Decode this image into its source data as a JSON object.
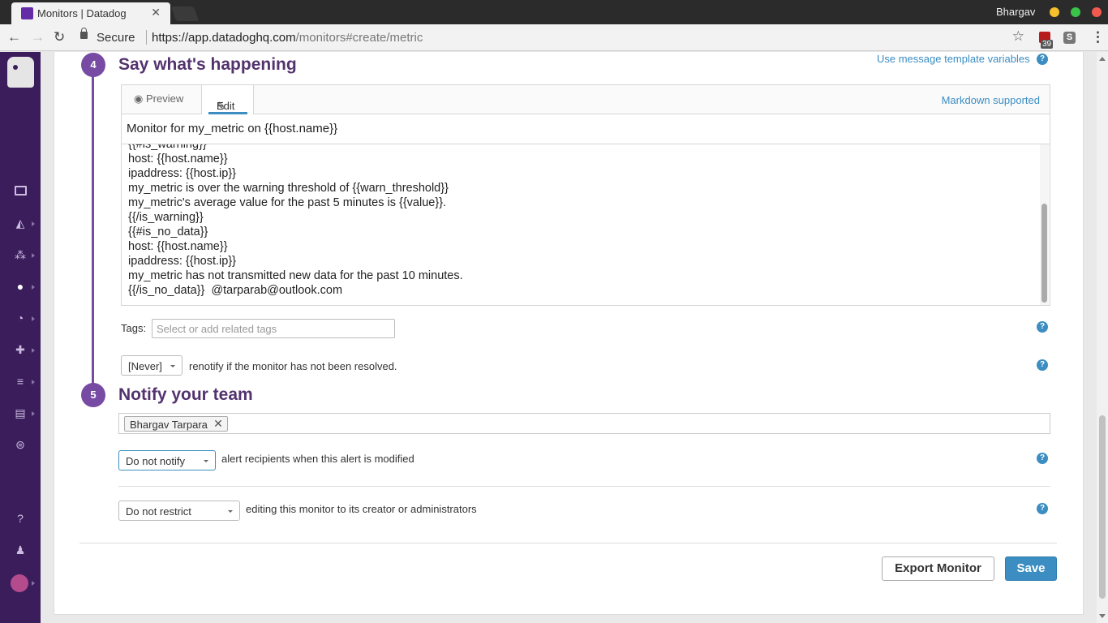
{
  "browser": {
    "tab_title": "Monitors | Datadog",
    "tab_close": "✕",
    "profile_name": "Bhargav",
    "secure_label": "Secure",
    "url_scheme_host": "https://app.datadoghq.com",
    "url_path": "/monitors#create/metric",
    "extension_badge": "39",
    "extension2_label": "S"
  },
  "section4": {
    "number": "4",
    "title": "Say what's happening",
    "template_link": "Use message template variables",
    "tab_preview": "Preview",
    "tab_edit": "Edit",
    "markdown_note": "Markdown supported",
    "subject": "Monitor for my_metric on {{host.name}}",
    "body_lines": [
      "{{#is_warning}}",
      "host: {{host.name}}",
      "ipaddress: {{host.ip}}",
      "my_metric is over the warning threshold of {{warn_threshold}}",
      "my_metric's average value for the past 5 minutes is {{value}}.",
      "{{/is_warning}}",
      "{{#is_no_data}}",
      "host: {{host.name}}",
      "ipaddress: {{host.ip}}",
      "my_metric has not transmitted new data for the past 10 minutes.",
      "{{/is_no_data}}  @tarparab@outlook.com"
    ],
    "tags_label": "Tags:",
    "tags_placeholder": "Select or add related tags",
    "renotify_value": "[Never]",
    "renotify_text": "renotify if the monitor has not been resolved."
  },
  "section5": {
    "number": "5",
    "title": "Notify your team",
    "recipient_chip": "Bhargav Tarpara",
    "chip_remove": "✕",
    "notify_value": "Do not notify",
    "notify_text": "alert recipients when this alert is modified",
    "restrict_value": "Do not restrict",
    "restrict_text": "editing this monitor to its creator or administrators"
  },
  "footer": {
    "export_label": "Export Monitor",
    "save_label": "Save"
  },
  "icons": {
    "help": "?",
    "accent": "#774aa4",
    "link": "#3b8dc2"
  }
}
